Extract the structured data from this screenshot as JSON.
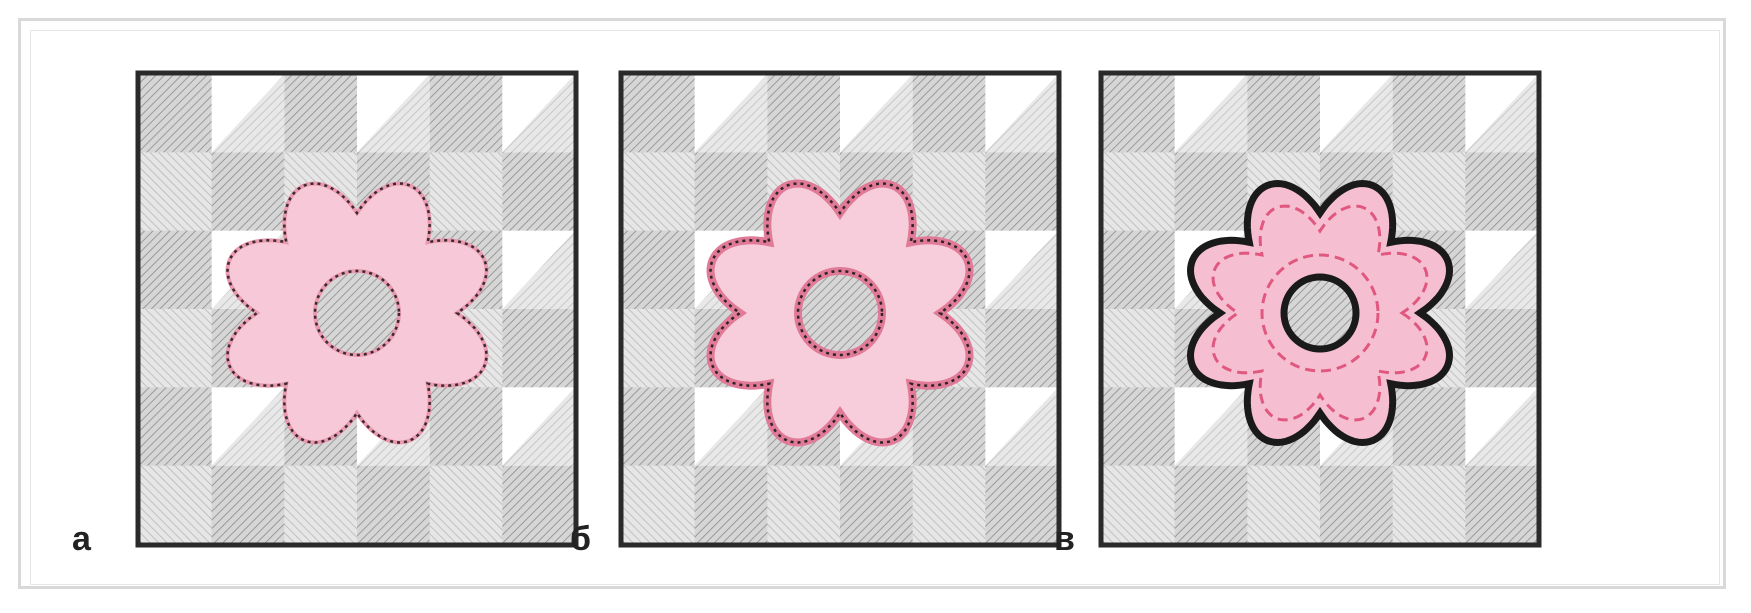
{
  "panels": [
    {
      "label": "а",
      "variant": "dashed-dark-stitch",
      "fill": "#f7c9d8",
      "stitch": "#3a2a2a"
    },
    {
      "label": "б",
      "variant": "pink-border-stitch",
      "fill": "#f8cddb",
      "stitch": "#2e2424",
      "border": "#e07a98"
    },
    {
      "label": "в",
      "variant": "outlined-dashed-pink",
      "fill": "#f6bfd1",
      "stitch": "#e0577f",
      "border": "#1a1a1a"
    }
  ],
  "colors": {
    "grid_dark": "#bdbdbd",
    "grid_mid": "#d6d6d6",
    "grid_light": "#ffffff",
    "frame": "#2a2a2a"
  }
}
